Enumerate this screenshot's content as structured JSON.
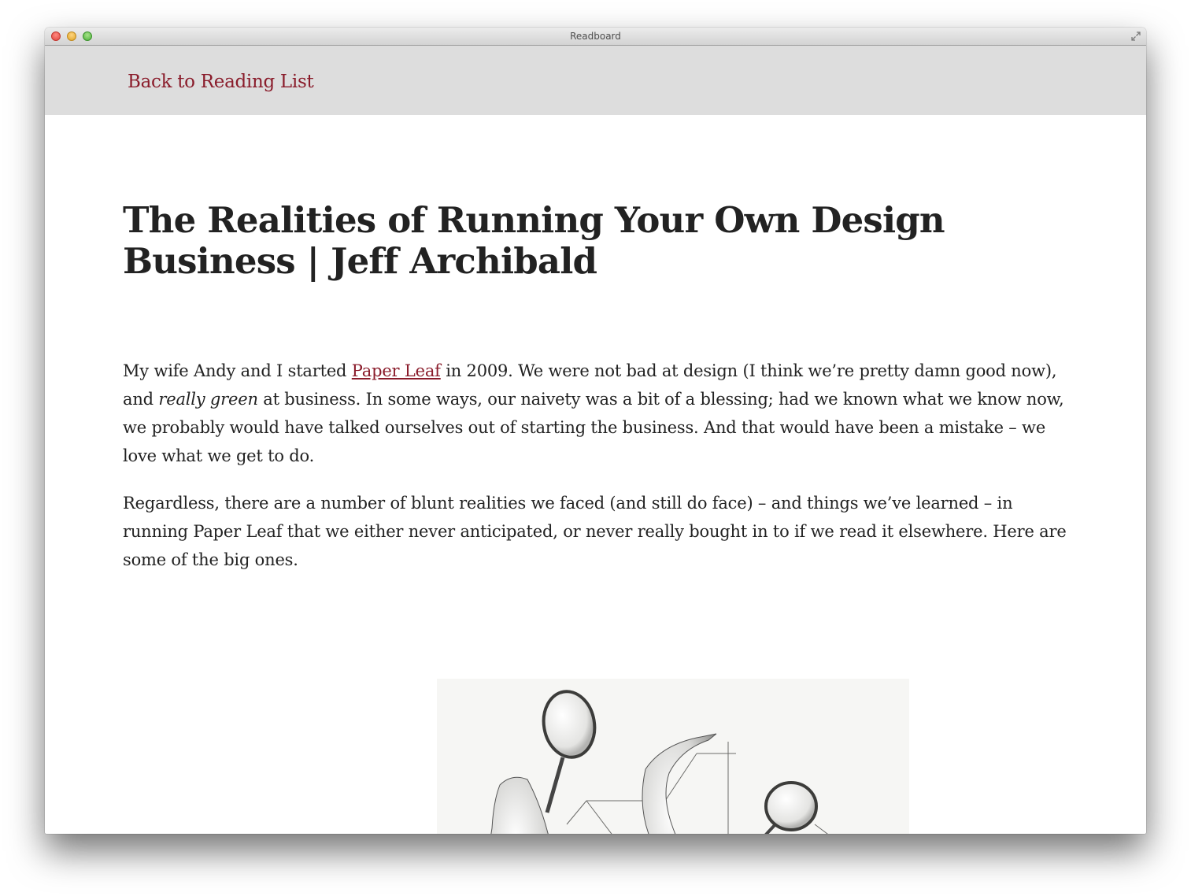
{
  "window": {
    "title": "Readboard"
  },
  "header": {
    "back_link": "Back to Reading List"
  },
  "article": {
    "title": "The Realities of Running Your Own Design Business | Jeff Archibald",
    "para1": {
      "before_link": "My wife Andy and I started ",
      "link_text": "Paper Leaf",
      "after_link": " in 2009. We were not bad at design (I think we’re pretty damn good now), and ",
      "emphasis": "really green",
      "rest": " at business. In some ways, our naivety was a bit of a blessing; had we known what we know now, we probably would have talked ourselves out of starting the business. And that would have been a mistake – we love what we get to do."
    },
    "para2": "Regardless, there are a number of blunt realities we faced (and still do face) – and things we’ve learned – in running Paper Leaf that we either never anticipated, or never really bought in to if we read it elsewhere. Here are some of the big ones."
  },
  "colors": {
    "link": "#8a1c2b",
    "header_bg": "#dddddd",
    "text": "#222222"
  }
}
